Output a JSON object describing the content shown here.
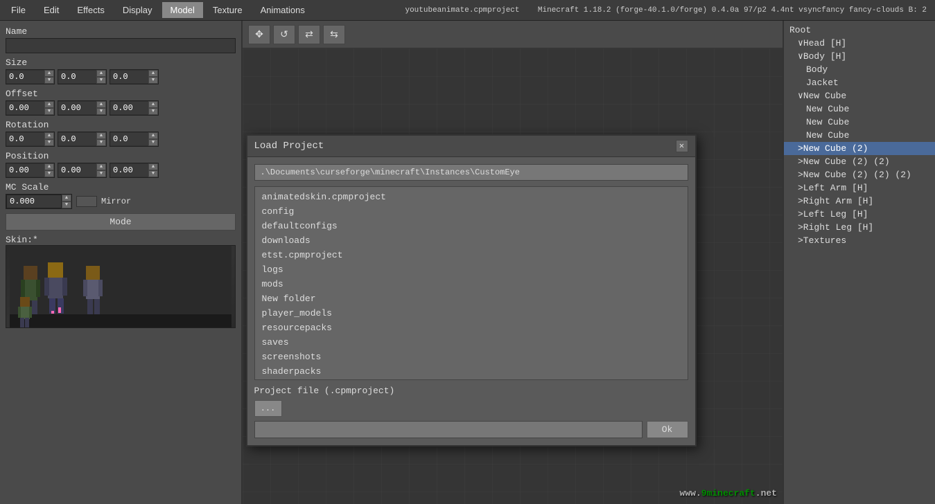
{
  "titlebar": {
    "title": "Minecraft 1.18.2 (forge-40.1.0/forge) 0.4.0a  97/p2 4.4nt  vsyncfancy fancy-clouds B: 2",
    "project": "youtubeanimate.cpmproject"
  },
  "menu": {
    "items": [
      {
        "label": "File",
        "active": false
      },
      {
        "label": "Edit",
        "active": false
      },
      {
        "label": "Effects",
        "active": false
      },
      {
        "label": "Display",
        "active": false
      },
      {
        "label": "Model",
        "active": true
      },
      {
        "label": "Texture",
        "active": false
      },
      {
        "label": "Animations",
        "active": false
      }
    ]
  },
  "left_panel": {
    "name_label": "Name",
    "name_value": "",
    "size_label": "Size",
    "size_x": "0.0",
    "size_y": "0.0",
    "size_z": "0.0",
    "offset_label": "Offset",
    "offset_x": "0.00",
    "offset_y": "0.00",
    "offset_z": "0.00",
    "rotation_label": "Rotation",
    "rotation_x": "0.0",
    "rotation_y": "0.0",
    "rotation_z": "0.0",
    "position_label": "Position",
    "position_x": "0.00",
    "position_y": "0.00",
    "position_z": "0.00",
    "mcscale_label": "MC Scale",
    "mcscale_value": "0.000",
    "mirror_label": "Mirror",
    "mode_label": "Mode",
    "skin_label": "Skin:*"
  },
  "toolbar": {
    "move_icon": "✥",
    "rotate_icon": "↺",
    "flip_icon": "⇄",
    "mirror_icon": "⇆"
  },
  "tree": {
    "items": [
      {
        "label": "Root",
        "indent": 0,
        "selected": false
      },
      {
        "label": "Head [H]",
        "indent": 1,
        "selected": false
      },
      {
        "label": "Body [H]",
        "indent": 1,
        "selected": false
      },
      {
        "label": "Body",
        "indent": 2,
        "selected": false
      },
      {
        "label": "Jacket",
        "indent": 2,
        "selected": false
      },
      {
        "label": "New Cube",
        "indent": 1,
        "selected": false
      },
      {
        "label": "New Cube",
        "indent": 2,
        "selected": false
      },
      {
        "label": "New Cube",
        "indent": 2,
        "selected": false
      },
      {
        "label": "New Cube",
        "indent": 2,
        "selected": false
      },
      {
        "label": "New Cube (2)",
        "indent": 1,
        "selected": true
      },
      {
        "label": "New Cube (2) (2)",
        "indent": 1,
        "selected": false
      },
      {
        "label": "New Cube (2) (2) (2)",
        "indent": 1,
        "selected": false
      },
      {
        "label": "Left Arm [H]",
        "indent": 1,
        "selected": false
      },
      {
        "label": "Right Arm [H]",
        "indent": 1,
        "selected": false
      },
      {
        "label": "Left Leg [H]",
        "indent": 1,
        "selected": false
      },
      {
        "label": "Right Leg [H]",
        "indent": 1,
        "selected": false
      },
      {
        "label": "Textures",
        "indent": 1,
        "selected": false
      }
    ]
  },
  "dialog": {
    "title": "Load Project",
    "close_btn": "✕",
    "path_value": ".\\Documents\\curseforge\\minecraft\\Instances\\CustomEye",
    "files": [
      {
        "name": "animatedskin.cpmproject",
        "selected": false
      },
      {
        "name": "config",
        "selected": false
      },
      {
        "name": "defaultconfigs",
        "selected": false
      },
      {
        "name": "downloads",
        "selected": false
      },
      {
        "name": "etst.cpmproject",
        "selected": false
      },
      {
        "name": "logs",
        "selected": false
      },
      {
        "name": "mods",
        "selected": false
      },
      {
        "name": "New folder",
        "selected": false
      },
      {
        "name": "player_models",
        "selected": false
      },
      {
        "name": "resourcepacks",
        "selected": false
      },
      {
        "name": "saves",
        "selected": false
      },
      {
        "name": "screenshots",
        "selected": false
      },
      {
        "name": "shaderpacks",
        "selected": false
      }
    ],
    "project_label": "Project file (.cpmproject)",
    "browse_btn": "...",
    "ok_btn": "Ok",
    "project_input_value": ""
  },
  "watermark": {
    "prefix": "www.",
    "site": "9minecraft",
    "suffix": ".net"
  }
}
